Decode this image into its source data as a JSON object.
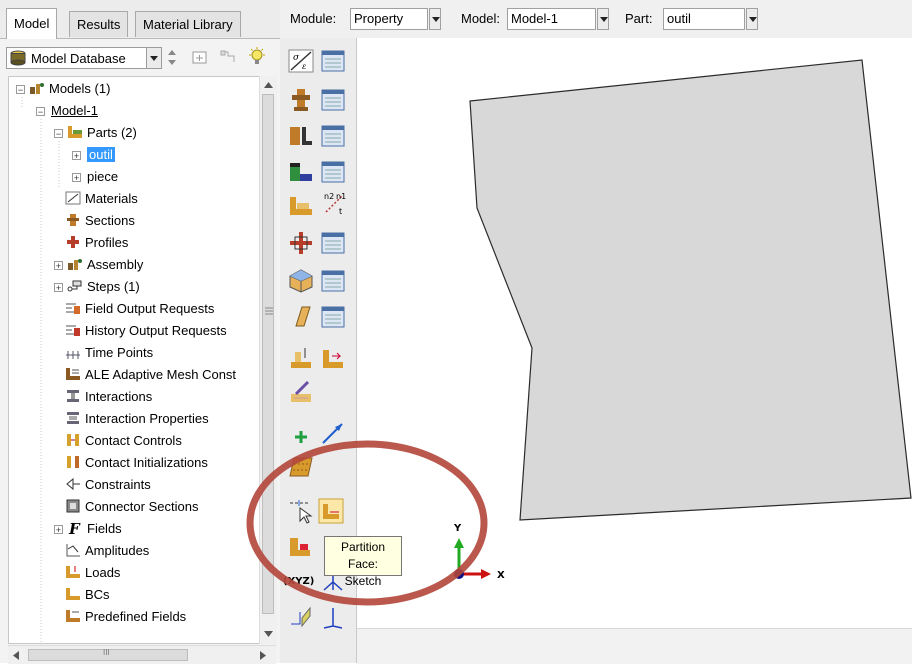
{
  "tabs": [
    {
      "label": "Model",
      "active": true
    },
    {
      "label": "Results",
      "active": false
    },
    {
      "label": "Material Library",
      "active": false
    }
  ],
  "model_database": {
    "label": "Model Database"
  },
  "tree": {
    "models": "Models (1)",
    "model1": "Model-1",
    "parts": "Parts (2)",
    "outil": "outil",
    "piece": "piece",
    "materials": "Materials",
    "sections": "Sections",
    "profiles": "Profiles",
    "assembly": "Assembly",
    "steps": "Steps (1)",
    "field_output": "Field Output Requests",
    "history_output": "History Output Requests",
    "time_points": "Time Points",
    "ale": "ALE Adaptive Mesh Const",
    "interactions": "Interactions",
    "interaction_props": "Interaction Properties",
    "contact_controls": "Contact Controls",
    "contact_init": "Contact Initializations",
    "constraints": "Constraints",
    "connector_sections": "Connector Sections",
    "fields": "Fields",
    "amplitudes": "Amplitudes",
    "loads": "Loads",
    "bcs": "BCs",
    "predefined": "Predefined Fields"
  },
  "topbar": {
    "module_label": "Module:",
    "module_value": "Property",
    "model_label": "Model:",
    "model_value": "Model-1",
    "part_label": "Part:",
    "part_value": "outil"
  },
  "tooltip": {
    "line1": "Partition Face:",
    "line2": "Sketch"
  },
  "triad": {
    "y": "Y",
    "x": "X"
  },
  "toolbox_text": {
    "xyz": "(XYZ)",
    "n1": "n1",
    "n2": "n2",
    "t": "t"
  },
  "scroll": {
    "h_mark": "III"
  },
  "colors": {
    "highlight_circle": "#b3463b",
    "part_fill": "#d8d8d8",
    "selection": "#3399ff"
  }
}
